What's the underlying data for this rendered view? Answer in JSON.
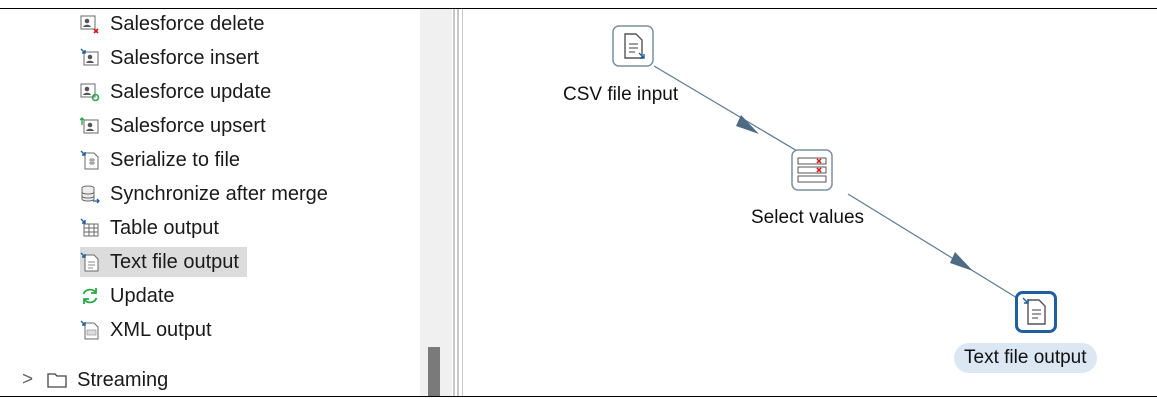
{
  "tree": {
    "items": [
      {
        "label": "Salesforce delete",
        "icon": "salesforce-delete-icon"
      },
      {
        "label": "Salesforce insert",
        "icon": "salesforce-insert-icon"
      },
      {
        "label": "Salesforce update",
        "icon": "salesforce-update-icon"
      },
      {
        "label": "Salesforce upsert",
        "icon": "salesforce-upsert-icon"
      },
      {
        "label": "Serialize to file",
        "icon": "serialize-file-icon"
      },
      {
        "label": "Synchronize after merge",
        "icon": "database-sync-icon"
      },
      {
        "label": "Table output",
        "icon": "table-output-icon"
      },
      {
        "label": "Text file output",
        "icon": "text-file-output-icon",
        "selected": true
      },
      {
        "label": "Update",
        "icon": "update-refresh-icon"
      },
      {
        "label": "XML output",
        "icon": "xml-output-icon"
      }
    ],
    "folder": {
      "label": "Streaming",
      "expander": ">",
      "icon": "folder-icon"
    }
  },
  "canvas": {
    "nodes": [
      {
        "label": "CSV file input",
        "icon": "csv-file-input-icon"
      },
      {
        "label": "Select values",
        "icon": "select-values-icon"
      },
      {
        "label": "Text file output",
        "icon": "text-file-output-icon",
        "selected": true
      }
    ]
  },
  "colors": {
    "accent": "#1f5f9e",
    "hop": "#5b7a96",
    "selectedRow": "#dcdcdc",
    "selectedLabel": "#dbe8f4"
  }
}
